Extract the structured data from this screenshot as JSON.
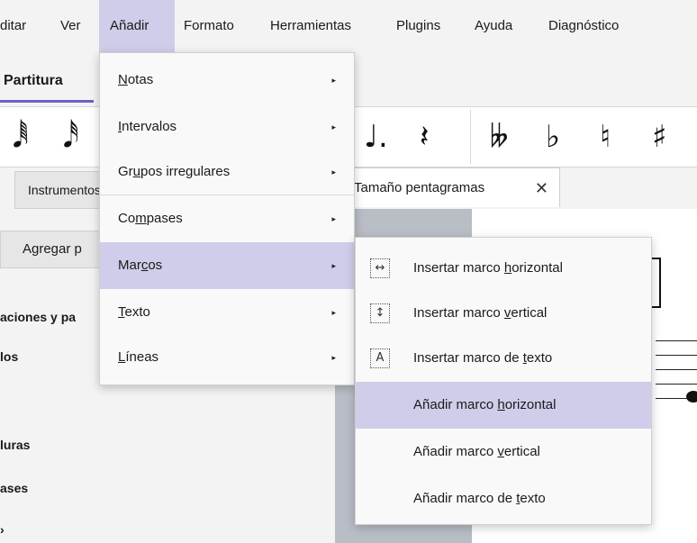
{
  "menubar": {
    "items": [
      "ditar",
      "Ver",
      "Añadir",
      "Formato",
      "Herramientas",
      "Plugins",
      "Ayuda",
      "Diagnóstico"
    ],
    "active": "Añadir"
  },
  "tabs": {
    "score_tab": "Partitura"
  },
  "toolbar": {
    "glyphs": [
      "𝅘𝅥𝅱",
      "𝅘𝅥𝅰",
      "♩.",
      "𝄽",
      "𝄫",
      "♭",
      "♮",
      "♯"
    ]
  },
  "secondary": {
    "instruments_button": "Instrumentos",
    "document_tab": "Tamaño pentagramas",
    "document_tab_close": "✕"
  },
  "left_panel": {
    "add_button": "Agregar p",
    "items": [
      "aciones y pa",
      "los",
      "luras",
      "ases",
      "›"
    ]
  },
  "add_menu": {
    "items": [
      {
        "pre": "",
        "u": "N",
        "post": "otas",
        "submenu": true
      },
      {
        "pre": "",
        "u": "I",
        "post": "ntervalos",
        "submenu": true
      },
      {
        "pre": "Gr",
        "u": "u",
        "post": "pos irregulares",
        "submenu": true
      },
      {
        "pre": "Co",
        "u": "m",
        "post": "pases",
        "submenu": true
      },
      {
        "pre": "Mar",
        "u": "c",
        "post": "os",
        "submenu": true,
        "highlighted": true
      },
      {
        "pre": "",
        "u": "T",
        "post": "exto",
        "submenu": true
      },
      {
        "pre": "",
        "u": "L",
        "post": "íneas",
        "submenu": true
      }
    ],
    "arrow": "▸"
  },
  "frames_submenu": {
    "items": [
      {
        "icon": "horizontal-frame-icon",
        "glyph": "↔",
        "pre": "Insertar marco ",
        "u": "h",
        "post": "orizontal"
      },
      {
        "icon": "vertical-frame-icon",
        "glyph": "↕",
        "pre": "Insertar marco ",
        "u": "v",
        "post": "ertical"
      },
      {
        "icon": "text-frame-icon",
        "glyph": "A",
        "pre": "Insertar marco de ",
        "u": "t",
        "post": "exto"
      },
      {
        "icon": "",
        "glyph": "",
        "pre": "Añadir marco ",
        "u": "h",
        "post": "orizontal",
        "highlighted": true
      },
      {
        "icon": "",
        "glyph": "",
        "pre": "Añadir marco ",
        "u": "v",
        "post": "ertical"
      },
      {
        "icon": "",
        "glyph": "",
        "pre": "Añadir marco de ",
        "u": "t",
        "post": "exto"
      }
    ]
  },
  "colors": {
    "highlight": "#cfcde9",
    "accent": "#6a63c4",
    "score_gray": "#b9bdc6"
  }
}
